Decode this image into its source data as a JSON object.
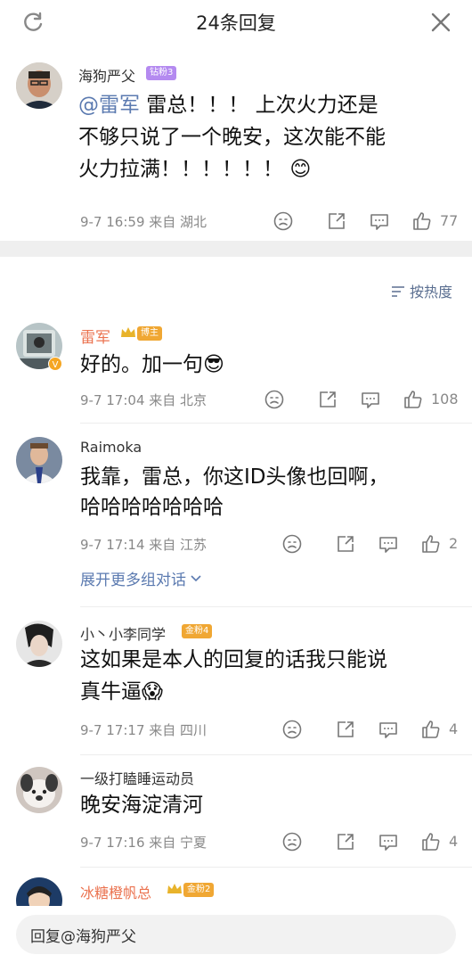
{
  "header": {
    "title": "24条回复",
    "refresh_icon": "refresh-icon",
    "close_icon": "close-icon"
  },
  "top_comment": {
    "username": "海狗严父",
    "badge": "钻粉3",
    "mention": "@雷军",
    "text_line1": " 雷总！！！ 上次火力还是",
    "text_line2": "不够只说了一个晚安，这次能不能",
    "text_line3": "火力拉满！！！！！！",
    "emoji": "😊",
    "time": "9-7 16:59",
    "location": "来自 湖北",
    "likes": "77"
  },
  "sort_label": "按热度",
  "replies": [
    {
      "username": "雷军",
      "badge": "博主",
      "text": "好的。加一句",
      "emoji": "😎",
      "time": "9-7 17:04",
      "location": "来自 北京",
      "likes": "108"
    },
    {
      "username": "Raimoka",
      "text_line1": "我靠，雷总，你这ID头像也回啊，",
      "text_line2": "哈哈哈哈哈哈哈",
      "time": "9-7 17:14",
      "location": "来自 江苏",
      "likes": "2"
    },
    {
      "username": "小丶小李同学",
      "badge": "金粉4",
      "text_line1": "这如果是本人的回复的话我只能说",
      "text_line2": "真牛逼",
      "emoji": "😱",
      "time": "9-7 17:17",
      "location": "来自 四川",
      "likes": "4"
    },
    {
      "username": "一级打瞌睡运动员",
      "text": "晚安海淀清河",
      "time": "9-7 17:16",
      "location": "来自 宁夏",
      "likes": "4"
    },
    {
      "username": "冰糖橙帆总",
      "badge": "金粉2"
    }
  ],
  "expand_label": "展开更多组对话",
  "reply_input": {
    "value": "回复@海狗严父"
  },
  "colors": {
    "link": "#5b7ab0",
    "orange": "#eb7350",
    "gray": "#888888",
    "separator": "#efefef"
  }
}
